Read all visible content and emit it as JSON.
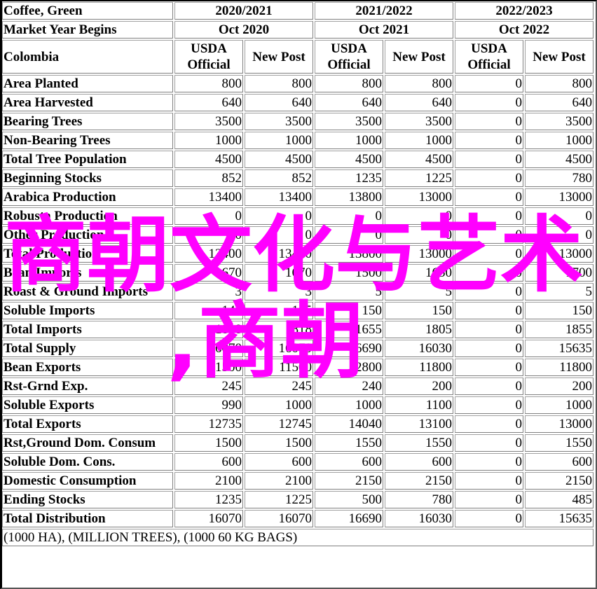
{
  "header": {
    "commodity": "Coffee, Green",
    "market_year_label": "Market Year Begins",
    "country": "Colombia",
    "years": [
      {
        "label": "2020/2021",
        "begins": "Oct 2020"
      },
      {
        "label": "2021/2022",
        "begins": "Oct 2021"
      },
      {
        "label": "2022/2023",
        "begins": "Oct 2022"
      }
    ],
    "columns": [
      {
        "label": "USDA Official"
      },
      {
        "label": "New Post"
      },
      {
        "label": "USDA Official"
      },
      {
        "label": "New Post"
      },
      {
        "label": "USDA Official"
      },
      {
        "label": "New Post"
      }
    ]
  },
  "rows": [
    {
      "label": "Area Planted",
      "values": [
        "800",
        "800",
        "800",
        "800",
        "0",
        "800"
      ]
    },
    {
      "label": "Area Harvested",
      "values": [
        "640",
        "640",
        "640",
        "640",
        "0",
        "640"
      ]
    },
    {
      "label": "Bearing Trees",
      "values": [
        "3500",
        "3500",
        "3500",
        "3500",
        "0",
        "3500"
      ]
    },
    {
      "label": "Non-Bearing Trees",
      "values": [
        "1000",
        "1000",
        "1000",
        "1000",
        "0",
        "1000"
      ]
    },
    {
      "label": "Total Tree Population",
      "values": [
        "4500",
        "4500",
        "4500",
        "4500",
        "0",
        "4500"
      ]
    },
    {
      "label": "Beginning Stocks",
      "values": [
        "852",
        "852",
        "1235",
        "1225",
        "0",
        "780"
      ]
    },
    {
      "label": "Arabica Production",
      "values": [
        "13400",
        "13400",
        "13800",
        "13000",
        "0",
        "13000"
      ]
    },
    {
      "label": "Robusta Production",
      "values": [
        "0",
        "0",
        "0",
        "0",
        "0",
        "0"
      ]
    },
    {
      "label": "Other Production",
      "values": [
        "0",
        "0",
        "0",
        "0",
        "0",
        "0"
      ]
    },
    {
      "label": "Total Production",
      "values": [
        "13400",
        "13400",
        "13800",
        "13000",
        "0",
        "13000"
      ]
    },
    {
      "label": "Bean Imports",
      "values": [
        "1670",
        "1670",
        "1500",
        "1650",
        "0",
        "1700"
      ]
    },
    {
      "label": "Roast & Ground Imports",
      "values": [
        "3",
        "3",
        "5",
        "5",
        "0",
        "5"
      ]
    },
    {
      "label": "Soluble Imports",
      "values": [
        "145",
        "145",
        "150",
        "150",
        "0",
        "150"
      ]
    },
    {
      "label": "Total Imports",
      "values": [
        "1818",
        "1818",
        "1655",
        "1805",
        "0",
        "1855"
      ]
    },
    {
      "label": "Total Supply",
      "values": [
        "16070",
        "16070",
        "16690",
        "16030",
        "0",
        "15635"
      ]
    },
    {
      "label": "Bean Exports",
      "values": [
        "11500",
        "11500",
        "12800",
        "11800",
        "0",
        "11800"
      ]
    },
    {
      "label": "Rst-Grnd Exp.",
      "values": [
        "245",
        "245",
        "240",
        "200",
        "0",
        "200"
      ]
    },
    {
      "label": "Soluble Exports",
      "values": [
        "990",
        "1000",
        "1000",
        "1100",
        "0",
        "1000"
      ]
    },
    {
      "label": "Total Exports",
      "values": [
        "12735",
        "12745",
        "14040",
        "13100",
        "0",
        "13000"
      ]
    },
    {
      "label": "Rst,Ground Dom. Consum",
      "values": [
        "1500",
        "1500",
        "1550",
        "1550",
        "0",
        "1550"
      ]
    },
    {
      "label": "Soluble Dom. Cons.",
      "values": [
        "600",
        "600",
        "600",
        "600",
        "0",
        "600"
      ]
    },
    {
      "label": "Domestic Consumption",
      "values": [
        "2100",
        "2100",
        "2150",
        "2150",
        "0",
        "2150"
      ]
    },
    {
      "label": "Ending Stocks",
      "values": [
        "1235",
        "1225",
        "500",
        "780",
        "0",
        "485"
      ]
    },
    {
      "label": "Total Distribution",
      "values": [
        "16070",
        "16070",
        "16690",
        "16030",
        "0",
        "15635"
      ]
    }
  ],
  "footer": {
    "units_note": "(1000 HA), (MILLION TREES), (1000 60 KG BAGS)"
  },
  "watermark": {
    "line1": "商朝文化与艺术",
    "line2": ",商朝",
    "color": "#ff00ff"
  }
}
